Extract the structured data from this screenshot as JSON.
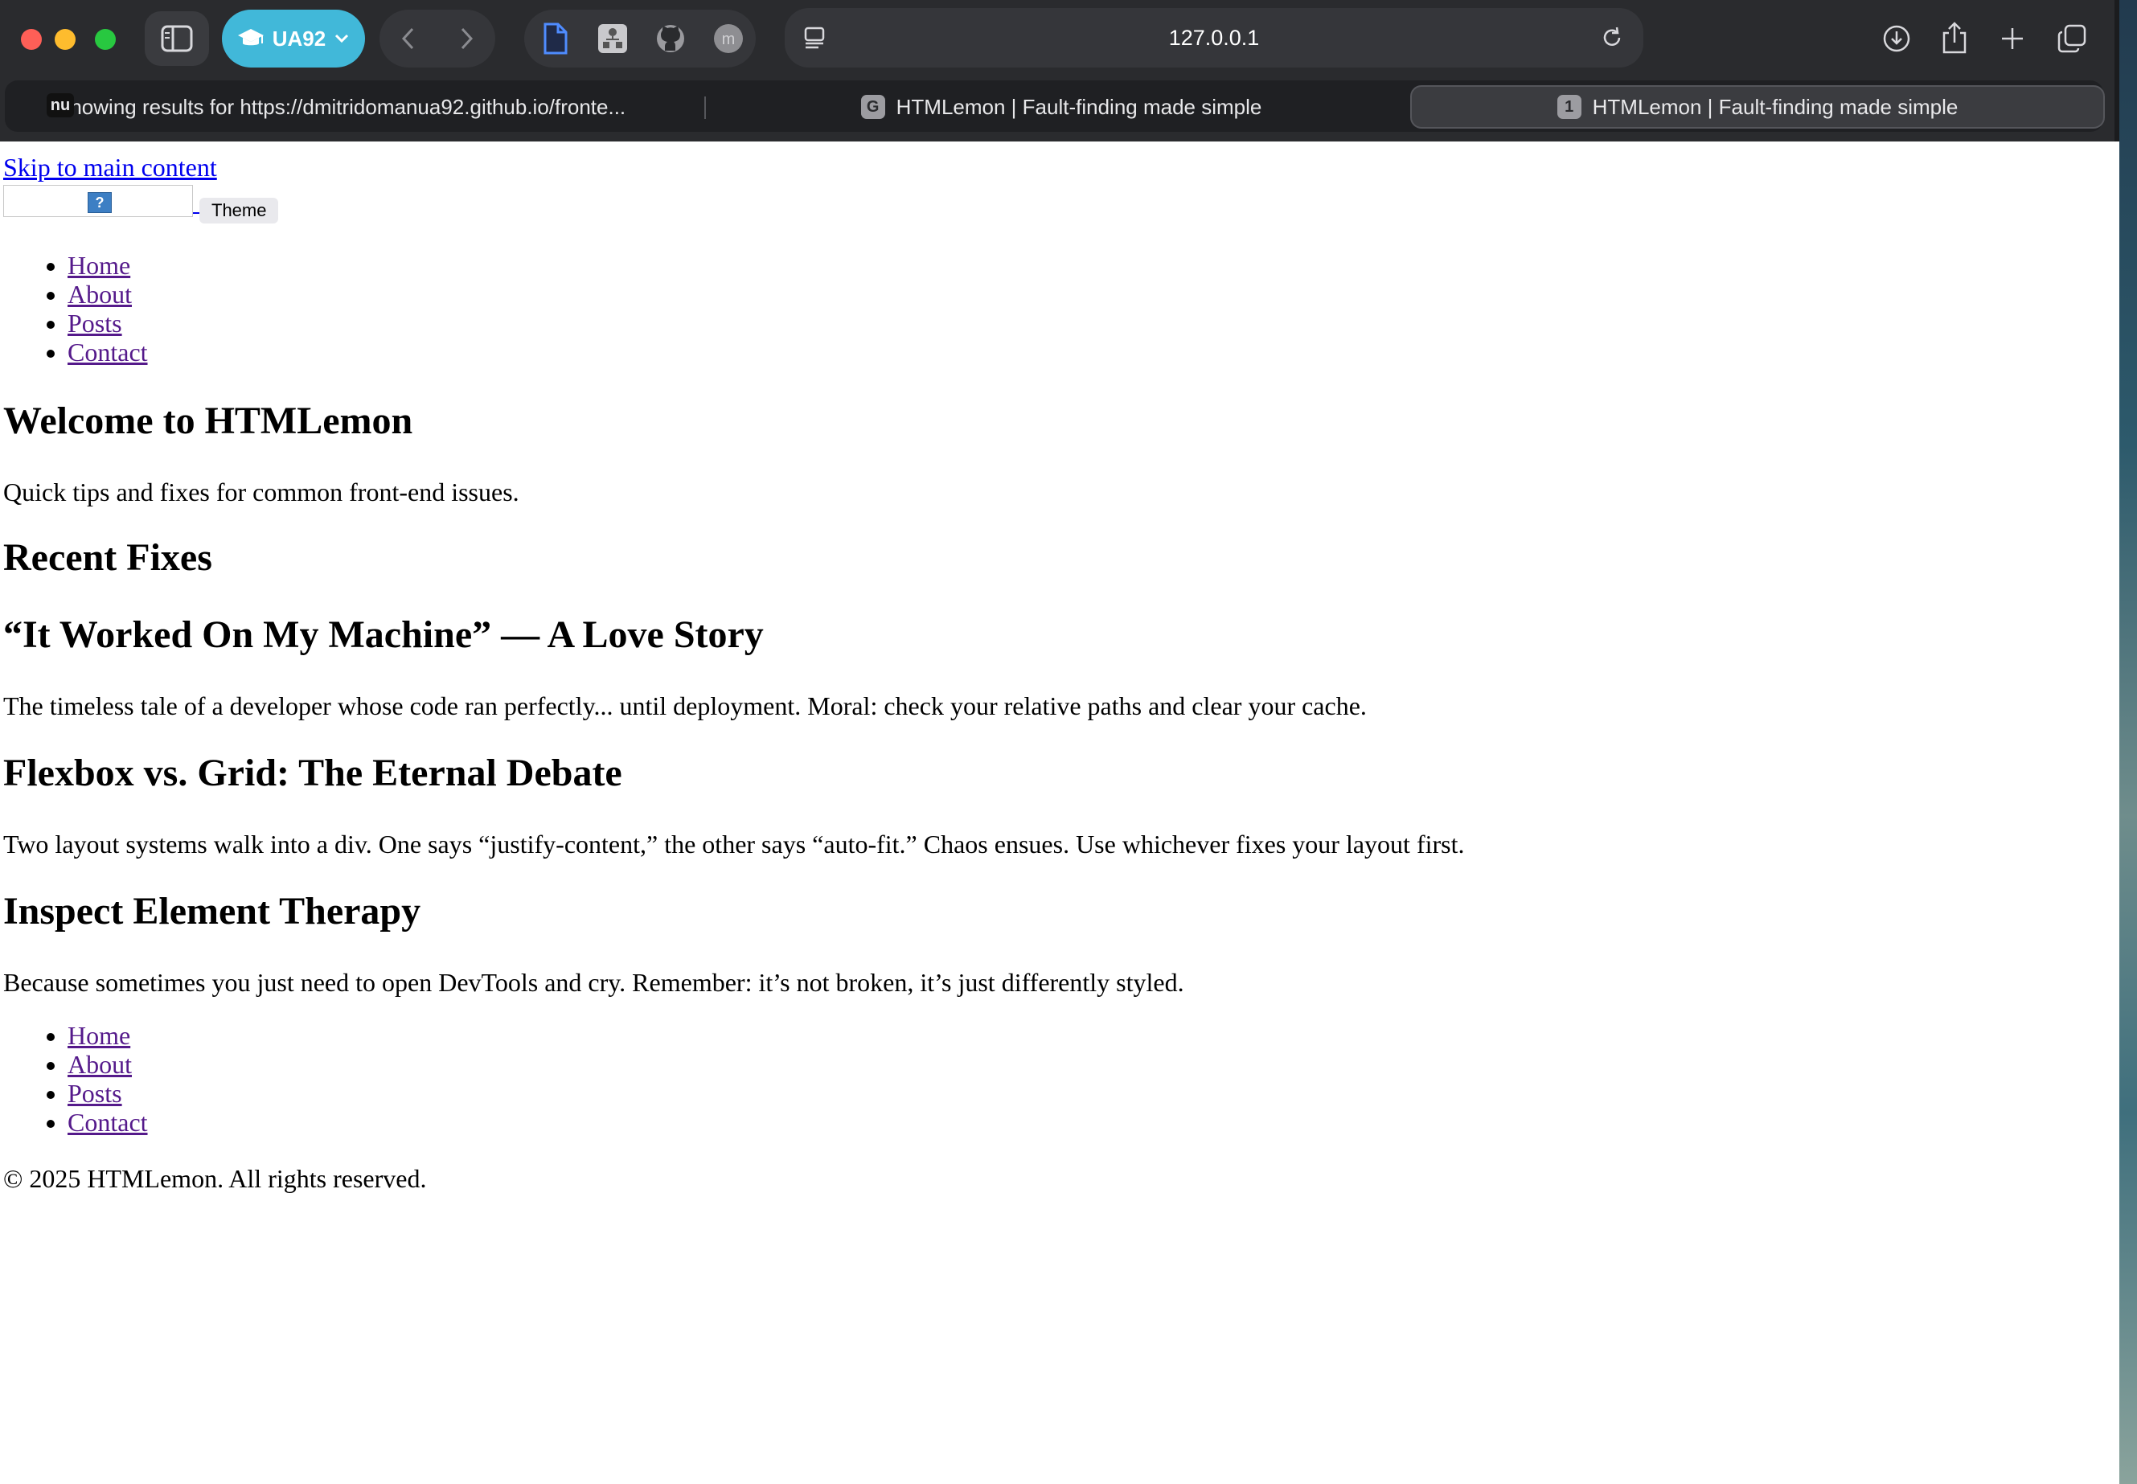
{
  "browser": {
    "profile_label": "UA92",
    "address": "127.0.0.1",
    "tabs": [
      {
        "label": "Showing results for https://dmitridomanua92.github.io/fronte...",
        "favicon_text": "nu"
      },
      {
        "label": "HTMLemon | Fault-finding made simple",
        "favicon_text": "G"
      },
      {
        "label": "HTMLemon | Fault-finding made simple",
        "favicon_text": "1",
        "active": true
      }
    ],
    "icons": {
      "sidebar": "sidebar-icon",
      "profile": "graduation-cap-icon",
      "back": "chevron-left-icon",
      "forward": "chevron-right-icon",
      "reader": "reader-icon",
      "reload": "reload-icon",
      "download": "download-icon",
      "share": "share-icon",
      "new_tab": "plus-icon",
      "tab_overview": "tab-overview-icon"
    },
    "colors": {
      "profile_accent": "#41b8d9",
      "chrome_bg": "#2a2b2e"
    }
  },
  "page": {
    "skip_link": "Skip to main content",
    "logo_icon_text": "?",
    "theme_button": "Theme",
    "nav": [
      "Home",
      "About",
      "Posts",
      "Contact"
    ],
    "hero": {
      "title": "Welcome to HTMLemon",
      "subtitle": "Quick tips and fixes for common front-end issues."
    },
    "recent_title": "Recent Fixes",
    "posts": [
      {
        "title": "“It Worked On My Machine” — A Love Story",
        "body": "The timeless tale of a developer whose code ran perfectly... until deployment. Moral: check your relative paths and clear your cache."
      },
      {
        "title": "Flexbox vs. Grid: The Eternal Debate",
        "body": "Two layout systems walk into a div. One says “justify-content,” the other says “auto-fit.” Chaos ensues. Use whichever fixes your layout first."
      },
      {
        "title": "Inspect Element Therapy",
        "body": "Because sometimes you just need to open DevTools and cry. Remember: it’s not broken, it’s just differently styled."
      }
    ],
    "footer_nav": [
      "Home",
      "About",
      "Posts",
      "Contact"
    ],
    "copyright": "© 2025 HTMLemon. All rights reserved."
  }
}
